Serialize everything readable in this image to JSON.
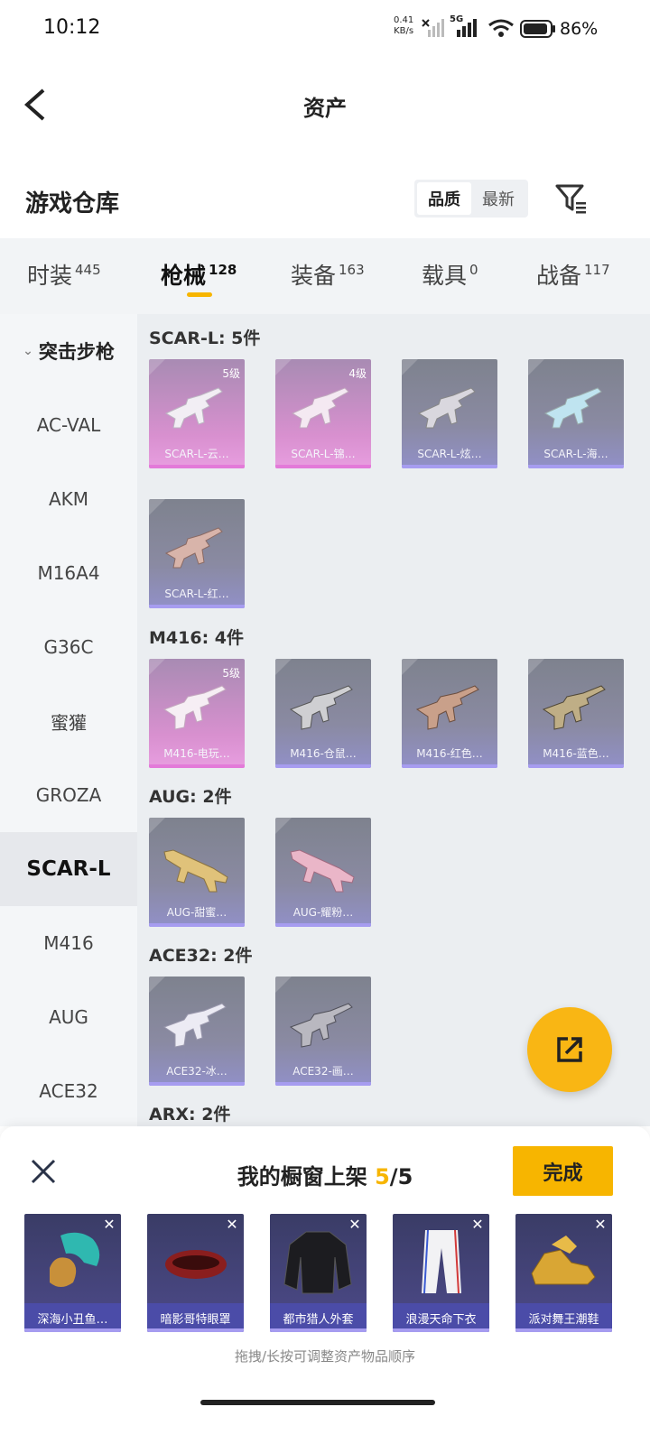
{
  "status_bar": {
    "time": "10:12",
    "net_speed_value": "0.41",
    "net_speed_unit": "KB/s",
    "network": "5G",
    "battery": "86%"
  },
  "header": {
    "title": "资产"
  },
  "section": {
    "title": "游戏仓库",
    "sort_options": [
      "品质",
      "最新"
    ],
    "sort_active": "品质"
  },
  "tabs": [
    {
      "label": "时装",
      "count": "445"
    },
    {
      "label": "枪械",
      "count": "128",
      "active": true
    },
    {
      "label": "装备",
      "count": "163"
    },
    {
      "label": "载具",
      "count": "0"
    },
    {
      "label": "战备",
      "count": "117"
    }
  ],
  "sidebar": {
    "category": "突击步枪",
    "items": [
      "AC-VAL",
      "AKM",
      "M16A4",
      "G36C",
      "蜜獾",
      "GROZA",
      "SCAR-L",
      "M416",
      "AUG",
      "ACE32"
    ],
    "selected": "SCAR-L"
  },
  "groups": [
    {
      "title": "SCAR-L: 5件",
      "items": [
        {
          "name": "SCAR-L-云…",
          "level": "5级",
          "rarity": "pink"
        },
        {
          "name": "SCAR-L-锦…",
          "level": "4级",
          "rarity": "pink"
        },
        {
          "name": "SCAR-L-炫…",
          "level": "",
          "rarity": "purple"
        },
        {
          "name": "SCAR-L-海…",
          "level": "",
          "rarity": "purple"
        },
        {
          "name": "SCAR-L-红…",
          "level": "",
          "rarity": "purple"
        }
      ]
    },
    {
      "title": "M416: 4件",
      "items": [
        {
          "name": "M416-电玩…",
          "level": "5级",
          "rarity": "pink"
        },
        {
          "name": "M416-仓鼠…",
          "level": "",
          "rarity": "purple"
        },
        {
          "name": "M416-红色…",
          "level": "",
          "rarity": "purple"
        },
        {
          "name": "M416-蓝色…",
          "level": "",
          "rarity": "purple"
        }
      ]
    },
    {
      "title": "AUG: 2件",
      "items": [
        {
          "name": "AUG-甜蜜…",
          "level": "",
          "rarity": "purple"
        },
        {
          "name": "AUG-耀粉…",
          "level": "",
          "rarity": "purple"
        }
      ]
    },
    {
      "title": "ACE32: 2件",
      "items": [
        {
          "name": "ACE32-冰…",
          "level": "",
          "rarity": "purple"
        },
        {
          "name": "ACE32-画…",
          "level": "",
          "rarity": "purple"
        }
      ]
    },
    {
      "title": "ARX: 2件",
      "items": []
    }
  ],
  "showcase": {
    "title": "我的橱窗上架",
    "count_current": "5",
    "count_total": "/5",
    "done_label": "完成",
    "items": [
      "深海小丑鱼…",
      "暗影哥特眼罩",
      "都市猎人外套",
      "浪漫天命下衣",
      "派对舞王潮鞋"
    ],
    "hint": "拖拽/长按可调整资产物品顺序"
  },
  "colors": {
    "accent": "#f7b500",
    "pink_rarity": "#e37ad9",
    "purple_rarity": "#a69cf0"
  }
}
